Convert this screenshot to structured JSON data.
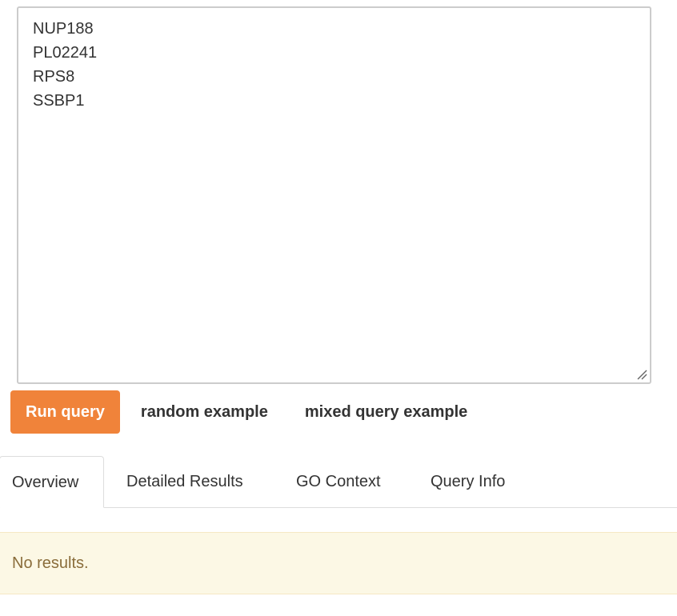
{
  "query": {
    "lines": [
      "NUP188",
      "PL02241",
      "RPS8",
      "SSBP1"
    ]
  },
  "actions": {
    "run_label": "Run query",
    "random_label": "random example",
    "mixed_label": "mixed query example"
  },
  "tabs": [
    {
      "label": "Overview",
      "active": true
    },
    {
      "label": "Detailed Results",
      "active": false
    },
    {
      "label": "GO Context",
      "active": false
    },
    {
      "label": "Query Info",
      "active": false
    }
  ],
  "alert": {
    "text": "No results."
  },
  "colors": {
    "run_button": "#f0833a",
    "alert_background": "#fcf8e5",
    "alert_text": "#8a6d3b"
  },
  "icons": {
    "textarea_resize": "resize-grip-icon"
  }
}
